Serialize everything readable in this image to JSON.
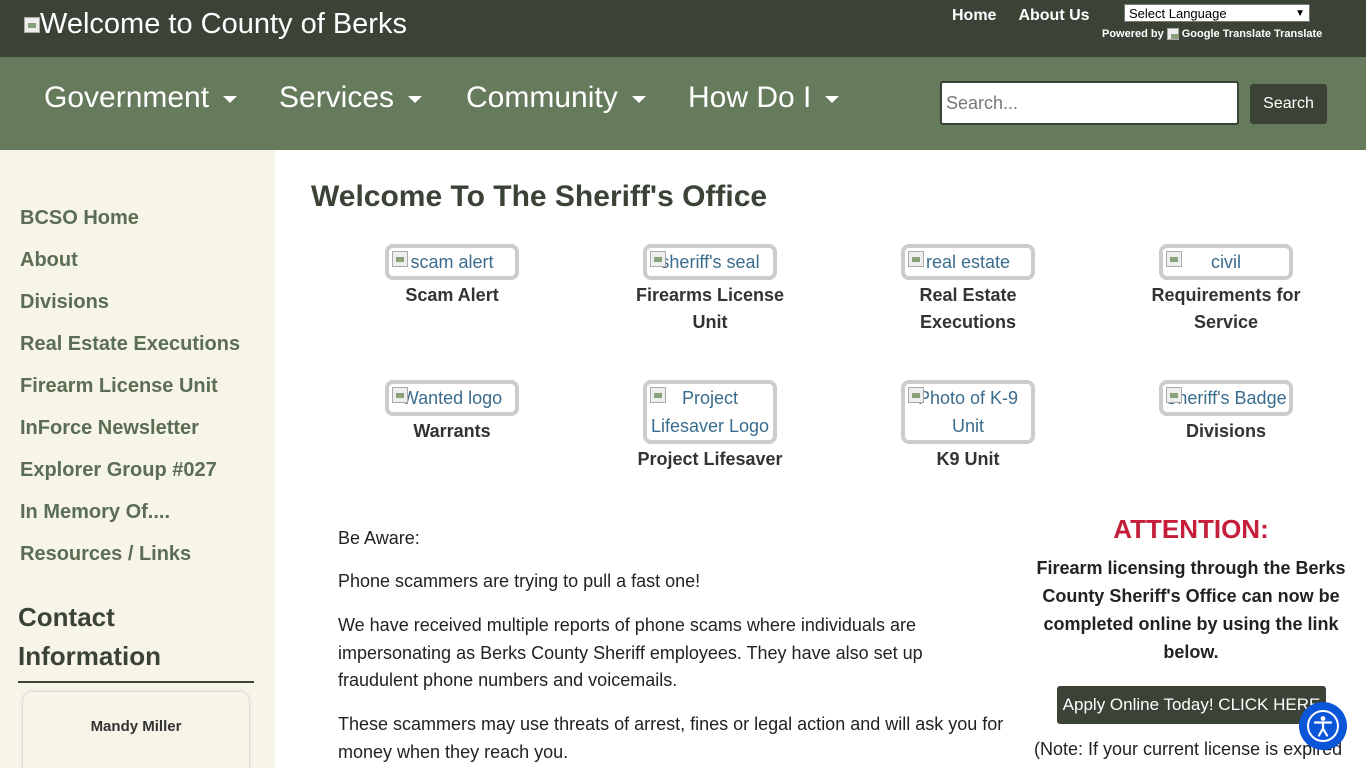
{
  "header": {
    "logo_alt": "Welcome to County of Berks",
    "links": [
      "Home",
      "About Us"
    ],
    "language_select": "Select Language",
    "powered_by": "Powered by",
    "google_translate_alt": "Google Translate",
    "translate_label": "Translate"
  },
  "nav": {
    "items": [
      "Government",
      "Services",
      "Community",
      "How Do I"
    ],
    "search_placeholder": "Search...",
    "search_button": "Search"
  },
  "sidebar": {
    "links": [
      "BCSO Home",
      "About",
      "Divisions",
      "Real Estate Executions",
      "Firearm License Unit",
      "InForce Newsletter",
      "Explorer Group #027",
      "In Memory Of....",
      "Resources / Links"
    ],
    "contact_title": "Contact Information",
    "contact_name": "Mandy Miller"
  },
  "main": {
    "title": "Welcome To The Sheriff's Office",
    "tiles": [
      {
        "alt": "scam alert",
        "label": "Scam Alert"
      },
      {
        "alt": "sheriff's seal",
        "label": "Firearms License Unit"
      },
      {
        "alt": "real estate",
        "label": "Real Estate Executions"
      },
      {
        "alt": "civil",
        "label": "Requirements for Service"
      },
      {
        "alt": "Wanted logo",
        "label": "Warrants"
      },
      {
        "alt": "Project Lifesaver Logo",
        "label": "Project Lifesaver"
      },
      {
        "alt": "Photo of K-9 Unit",
        "label": "K9 Unit"
      },
      {
        "alt": "Sheriff's Badge",
        "label": "Divisions"
      }
    ],
    "paragraphs": [
      "Be Aware:",
      "Phone scammers are trying to pull a fast one!",
      "We have received multiple reports of phone scams where individuals are impersonating as Berks County Sheriff employees. They have also set up fraudulent phone numbers and voicemails.",
      "These scammers may use threats of arrest, fines or legal action and will ask you for money when they reach you."
    ]
  },
  "attention": {
    "title": "ATTENTION:",
    "text": "Firearm licensing through the Berks County Sheriff's Office can now be completed online by using the link below.",
    "button": "Apply Online Today! CLICK HERE",
    "note": "(Note: If your current license is expired"
  },
  "colors": {
    "topbar": "#3b4236",
    "navbar": "#667a5c",
    "sidebar_bg": "#f7f4e8",
    "sidebar_link": "#5b6e53",
    "attention_red": "#c41e3a",
    "accessibility_blue": "#0b55d8"
  },
  "icons": [
    "broken-image-icon",
    "dropdown-caret-icon",
    "accessibility-icon"
  ]
}
